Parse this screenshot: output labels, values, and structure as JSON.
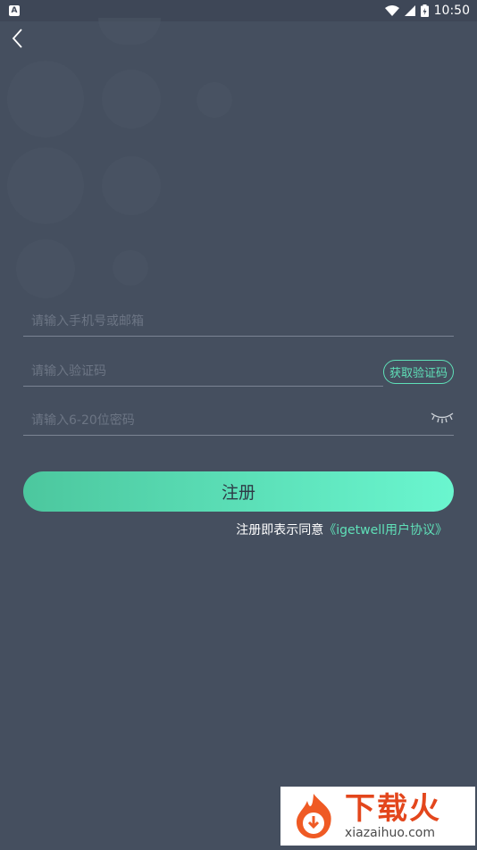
{
  "statusbar": {
    "time": "10:50",
    "notif_letter": "A"
  },
  "inputs": {
    "account_placeholder": "请输入手机号或邮箱",
    "code_placeholder": "请输入验证码",
    "password_placeholder": "请输入6-20位密码"
  },
  "buttons": {
    "get_code": "获取验证码",
    "register": "注册"
  },
  "agreement": {
    "prefix": "注册即表示同意",
    "link": "《igetwell用户协议》"
  },
  "watermark": {
    "brand": "下载火",
    "domain": "xiazaihuo.com"
  },
  "colors": {
    "background": "#454f5f",
    "accent": "#5fe0b8",
    "watermark_red": "#e3461c"
  }
}
